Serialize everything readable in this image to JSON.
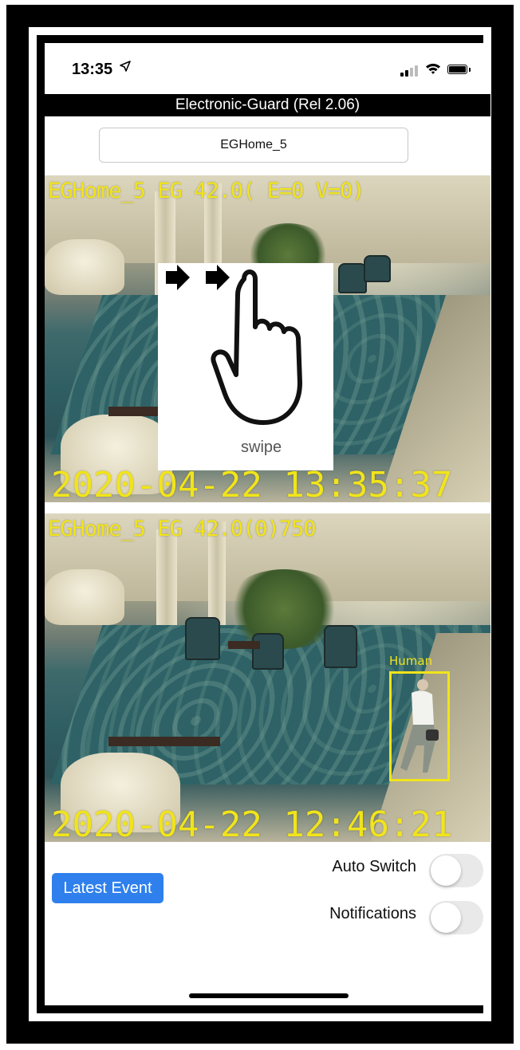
{
  "status_bar": {
    "time": "13:35",
    "location_icon": "location-arrow-icon"
  },
  "app": {
    "title": "Electronic-Guard (Rel 2.06)"
  },
  "camera_select": {
    "value": "EGHome_5"
  },
  "live_view": {
    "overlay_text": "EGHome_5 EG 42.0( E=0 V=0)",
    "timestamp": "2020-04-22 13:35:37",
    "gesture_hint": "swipe"
  },
  "event_view": {
    "overlay_text": "EGHome_5 EG 42.0(0)750",
    "timestamp": "2020-04-22 12:46:21",
    "detection_label": "Human"
  },
  "controls": {
    "latest_event_label": "Latest Event",
    "auto_switch_label": "Auto Switch",
    "auto_switch_on": false,
    "notifications_label": "Notifications",
    "notifications_on": false
  },
  "colors": {
    "osd_yellow": "#f1e41a",
    "button_blue": "#2f80ed",
    "toggle_off": "#e9e9ea"
  }
}
